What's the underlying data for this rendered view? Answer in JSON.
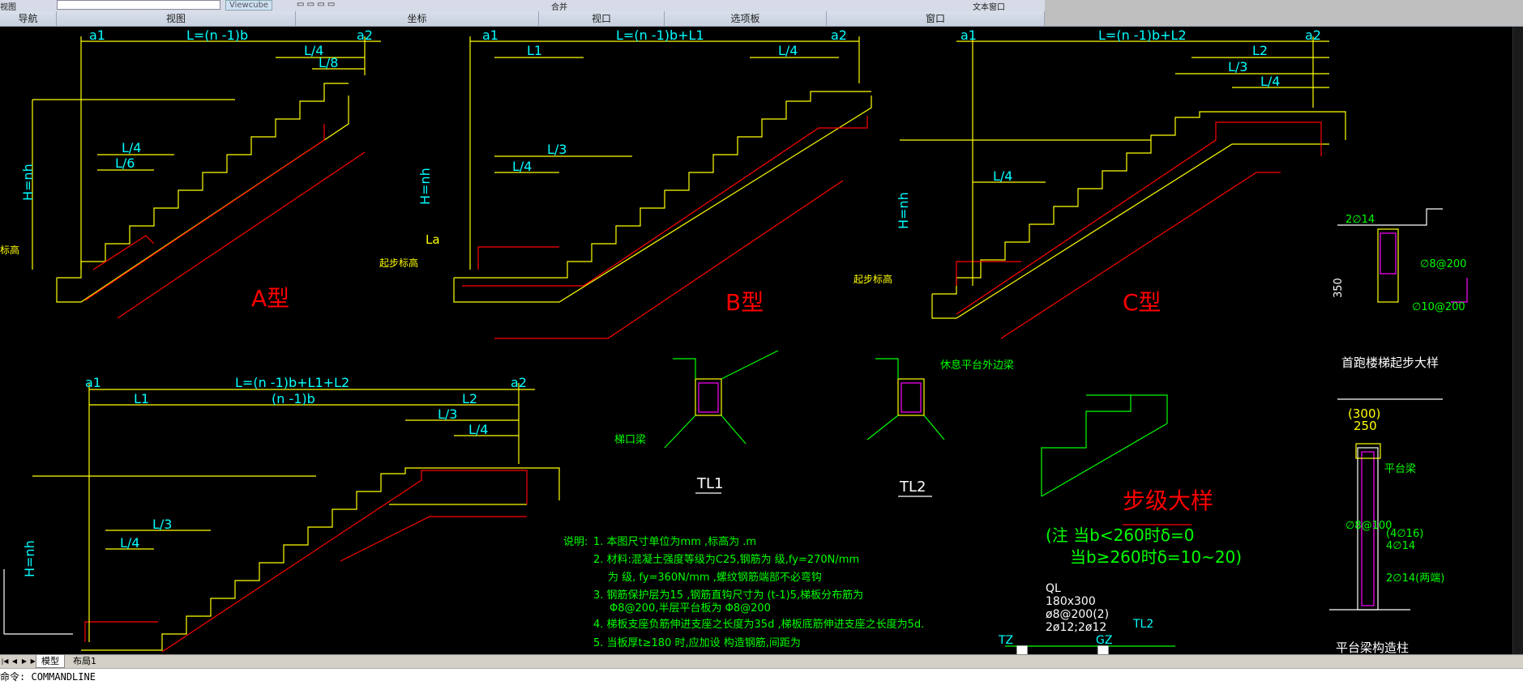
{
  "ribbon": {
    "top_left": "视图",
    "input_placeholder": "",
    "button_label": "Viewcube",
    "top_right_a": "合并",
    "top_right_b": "文本窗口",
    "panels": [
      "导航",
      "视图",
      "坐标",
      "视口",
      "选项板",
      "窗口"
    ]
  },
  "drawing": {
    "type_a": "A型",
    "type_b": "B型",
    "type_c": "C型",
    "dims": {
      "a_top": "L=(n -1)b",
      "b_top": "L=(n -1)b+L1",
      "c_top": "L=(n -1)b+L2",
      "d_top": "L=(n -1)b+L1+L2",
      "d_sub": "(n -1)b",
      "L1": "L1",
      "L2": "L2",
      "L3": "L/3",
      "L4": "L/4",
      "L6": "L/6",
      "L8": "L/8",
      "a1": "a1",
      "a2": "a2",
      "Hnh": "H=nh",
      "La": "La",
      "qibu": "起步标高",
      "biaogao": "标高"
    },
    "tl1": "TL1",
    "tl2": "TL2",
    "tl1_note": "梯口梁",
    "tl2_note": "休息平台外边梁",
    "step_detail_title": "步级大样",
    "step_note1": "(注 当b<260时δ=0",
    "step_note2": "当b≥260时δ=10~20)",
    "first_run_title": "首跑楼梯起步大样",
    "first_run_rebar1": "2∅14",
    "first_run_rebar2": "∅8@200",
    "first_run_rebar3": "∅10@200",
    "first_run_dim": "350",
    "platform_title": "平台梁构造柱",
    "platform_300": "(300)",
    "platform_250": "250",
    "platform_r1": "∅8@100",
    "platform_r2": "(4∅16)",
    "platform_r3": "4∅14",
    "platform_r4": "2∅14(两端)",
    "platform_note": "平台梁",
    "notes_label": "说明:",
    "notes": [
      "1. 本图尺寸单位为mm ,标高为 .m",
      "2. 材料:混凝土强度等级为C25,钢筋为 级,fy=270N/mm",
      "为 级, fy=360N/mm ,螺纹钢筋端部不必弯钩",
      "3. 钢筋保护层为15 ,钢筋直钩尺寸为 (t-1)5,梯板分布筋为",
      "Φ8@200,半层平台板为 Φ8@200",
      "4. 梯板支座负筋伸进支座之长度为35d ,梯板底筋伸进支座之长度为5d.",
      "5. 当板厚t≥180 时,应加设 构造钢筋,间距为"
    ],
    "ql": [
      "QL",
      "180x300",
      "ø8@200(2)",
      "2ø12;2ø12"
    ],
    "tz": "TZ",
    "gz": "GZ",
    "tl2_label2": "TL2"
  },
  "tabs": {
    "model": "模型",
    "layout1": "布局1"
  },
  "command": {
    "prompt": "命令:",
    "value": "COMMANDLINE"
  },
  "colors": {
    "yellow": "#ffff00",
    "cyan": "#00ffff",
    "red": "#ff0000",
    "green": "#00ff00",
    "magenta": "#ff00ff",
    "white": "#ffffff"
  }
}
